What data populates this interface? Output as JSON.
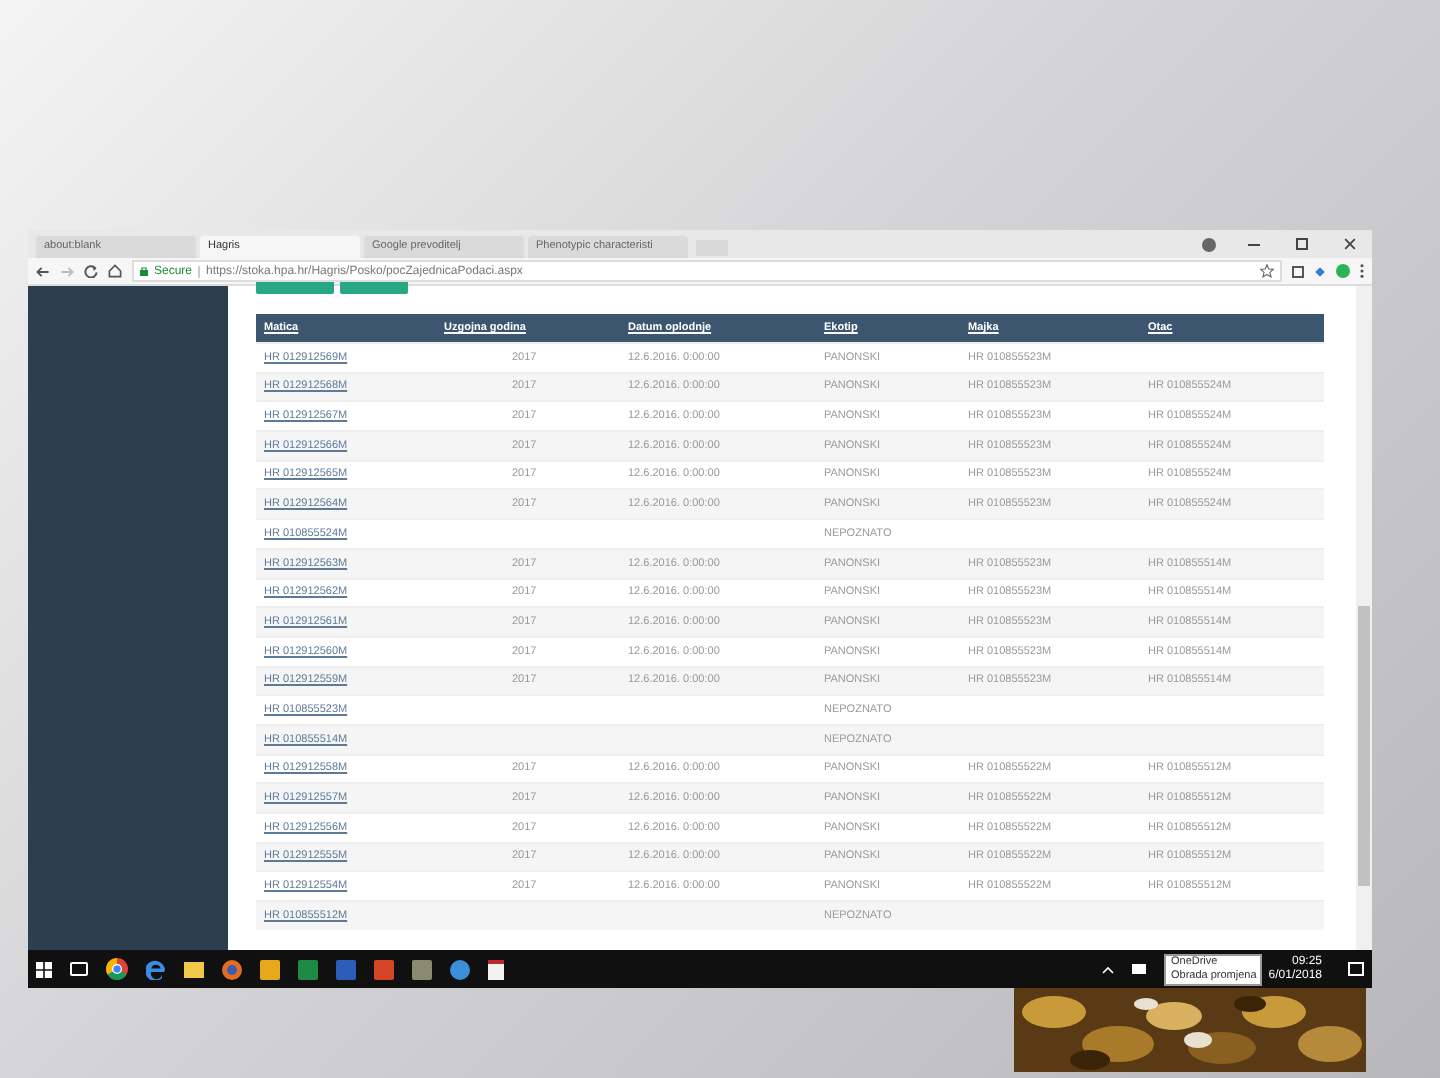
{
  "browser": {
    "tabs": [
      {
        "label": "about:blank",
        "selected": false
      },
      {
        "label": "Hagris",
        "selected": true
      },
      {
        "label": "Google prevoditelj",
        "selected": false
      },
      {
        "label": "Phenotypic characteristi",
        "selected": false
      }
    ],
    "secure_label": "Secure",
    "url": "https://stoka.hpa.hr/Hagris/Posko/pocZajednicaPodaci.aspx"
  },
  "table": {
    "columns": [
      "Matica",
      "Uzgojna godina",
      "Datum oplodnje",
      "Ekotip",
      "Majka",
      "Otac"
    ],
    "rows": [
      [
        "HR 012912569M",
        "2017",
        "12.6.2016. 0:00:00",
        "PANONSKI",
        "HR 010855523M",
        ""
      ],
      [
        "HR 012912568M",
        "2017",
        "12.6.2016. 0:00:00",
        "PANONSKI",
        "HR 010855523M",
        "HR 010855524M"
      ],
      [
        "HR 012912567M",
        "2017",
        "12.6.2016. 0:00:00",
        "PANONSKI",
        "HR 010855523M",
        "HR 010855524M"
      ],
      [
        "HR 012912566M",
        "2017",
        "12.6.2016. 0:00:00",
        "PANONSKI",
        "HR 010855523M",
        "HR 010855524M"
      ],
      [
        "HR 012912565M",
        "2017",
        "12.6.2016. 0:00:00",
        "PANONSKI",
        "HR 010855523M",
        "HR 010855524M"
      ],
      [
        "HR 012912564M",
        "2017",
        "12.6.2016. 0:00:00",
        "PANONSKI",
        "HR 010855523M",
        "HR 010855524M"
      ],
      [
        "HR 010855524M",
        "",
        "",
        "NEPOZNATO",
        "",
        ""
      ],
      [
        "HR 012912563M",
        "2017",
        "12.6.2016. 0:00:00",
        "PANONSKI",
        "HR 010855523M",
        "HR 010855514M"
      ],
      [
        "HR 012912562M",
        "2017",
        "12.6.2016. 0:00:00",
        "PANONSKI",
        "HR 010855523M",
        "HR 010855514M"
      ],
      [
        "HR 012912561M",
        "2017",
        "12.6.2016. 0:00:00",
        "PANONSKI",
        "HR 010855523M",
        "HR 010855514M"
      ],
      [
        "HR 012912560M",
        "2017",
        "12.6.2016. 0:00:00",
        "PANONSKI",
        "HR 010855523M",
        "HR 010855514M"
      ],
      [
        "HR 012912559M",
        "2017",
        "12.6.2016. 0:00:00",
        "PANONSKI",
        "HR 010855523M",
        "HR 010855514M"
      ],
      [
        "HR 010855523M",
        "",
        "",
        "NEPOZNATO",
        "",
        ""
      ],
      [
        "HR 010855514M",
        "",
        "",
        "NEPOZNATO",
        "",
        ""
      ],
      [
        "HR 012912558M",
        "2017",
        "12.6.2016. 0:00:00",
        "PANONSKI",
        "HR 010855522M",
        "HR 010855512M"
      ],
      [
        "HR 012912557M",
        "2017",
        "12.6.2016. 0:00:00",
        "PANONSKI",
        "HR 010855522M",
        "HR 010855512M"
      ],
      [
        "HR 012912556M",
        "2017",
        "12.6.2016. 0:00:00",
        "PANONSKI",
        "HR 010855522M",
        "HR 010855512M"
      ],
      [
        "HR 012912555M",
        "2017",
        "12.6.2016. 0:00:00",
        "PANONSKI",
        "HR 010855522M",
        "HR 010855512M"
      ],
      [
        "HR 012912554M",
        "2017",
        "12.6.2016. 0:00:00",
        "PANONSKI",
        "HR 010855522M",
        "HR 010855512M"
      ],
      [
        "HR 010855512M",
        "",
        "",
        "NEPOZNATO",
        "",
        ""
      ]
    ]
  },
  "taskbar": {
    "tooltip": [
      "OneDrive",
      "Obrada promjena"
    ],
    "time": "09:25",
    "date": "6/01/2018"
  }
}
